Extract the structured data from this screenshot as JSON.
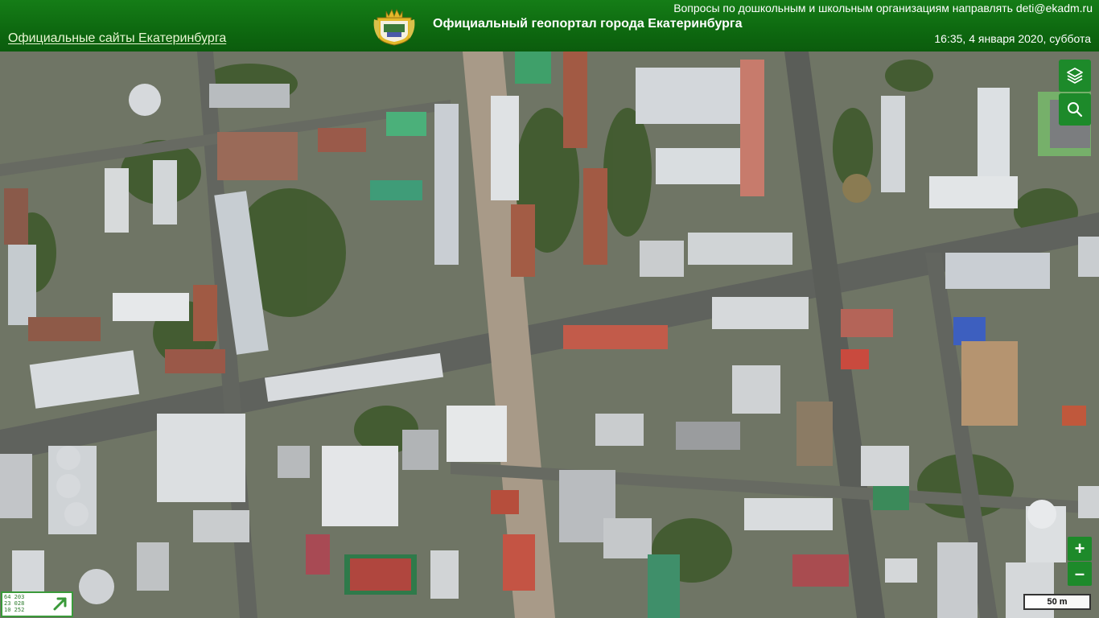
{
  "header": {
    "sites_link": "Официальные сайты Екатеринбурга",
    "title": "Официальный геопортал города Екатеринбурга",
    "contact": "Вопросы по дошкольным и школьным организациям направлять deti@ekadm.ru",
    "datetime": "16:35, 4 января 2020, суббота",
    "emblem_icon": "city-coat-of-arms"
  },
  "map_controls": {
    "layers_icon": "layers-icon",
    "search_icon": "search-icon",
    "zoom_in": "+",
    "zoom_out": "–",
    "scale_label": "50 m",
    "colors": {
      "accent": "#1d8a2a",
      "header": "#0e6a10"
    }
  },
  "overview": {
    "coords": [
      "64 203",
      "23 028",
      "10 252"
    ],
    "arrow_icon": "expand-arrow-icon"
  }
}
